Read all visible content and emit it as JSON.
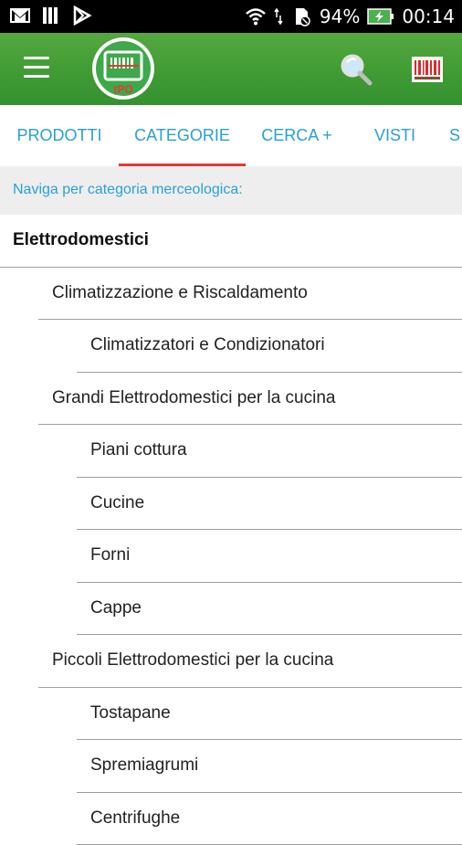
{
  "status_bar": {
    "battery_percent": "94%",
    "time": "00:14",
    "icons": [
      "gmail-icon",
      "sim-icon",
      "play-store-icon",
      "wifi-icon",
      "data-icon",
      "no-sim-icon",
      "battery-charging-icon"
    ]
  },
  "app_bar": {
    "logo_text": "tPO",
    "icons": [
      "menu-icon",
      "search-icon",
      "barcode-icon"
    ],
    "brand_color": "#3e9a33"
  },
  "tabs": [
    {
      "label": "PRODOTTI",
      "active": false
    },
    {
      "label": "CATEGORIE",
      "active": true
    },
    {
      "label": "CERCA +",
      "active": false
    },
    {
      "label": "VISTI",
      "active": false
    },
    {
      "label": "S",
      "active": false
    }
  ],
  "subheader": {
    "text": "Naviga per categoria merceologica:"
  },
  "categories": [
    {
      "label": "Elettrodomestici",
      "level": 0
    },
    {
      "label": "Climatizzazione e Riscaldamento",
      "level": 1
    },
    {
      "label": "Climatizzatori e Condizionatori",
      "level": 2
    },
    {
      "label": "Grandi Elettrodomestici per la cucina",
      "level": 1
    },
    {
      "label": "Piani cottura",
      "level": 2
    },
    {
      "label": "Cucine",
      "level": 2
    },
    {
      "label": "Forni",
      "level": 2
    },
    {
      "label": "Cappe",
      "level": 2
    },
    {
      "label": "Piccoli Elettrodomestici per la cucina",
      "level": 1
    },
    {
      "label": "Tostapane",
      "level": 2
    },
    {
      "label": "Spremiagrumi",
      "level": 2
    },
    {
      "label": "Centrifughe",
      "level": 2
    }
  ],
  "colors": {
    "accent": "#2a9fd6",
    "tab_indicator": "#e53935",
    "divider": "#9e9e9e"
  }
}
